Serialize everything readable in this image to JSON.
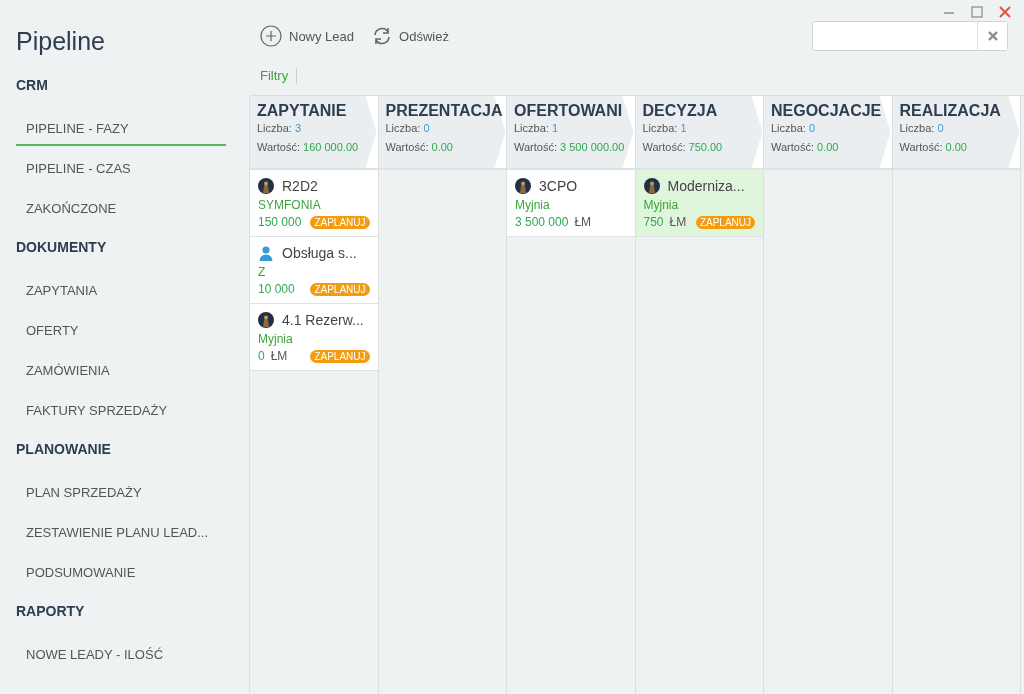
{
  "window": {
    "title": "Pipeline"
  },
  "sidebar": {
    "sections": [
      {
        "label": "CRM",
        "items": [
          {
            "label": "PIPELINE - FAZY",
            "selected": true
          },
          {
            "label": "PIPELINE - CZAS",
            "selected": false
          },
          {
            "label": "ZAKOŃCZONE",
            "selected": false
          }
        ]
      },
      {
        "label": "DOKUMENTY",
        "items": [
          {
            "label": "ZAPYTANIA",
            "selected": false
          },
          {
            "label": "OFERTY",
            "selected": false
          },
          {
            "label": "ZAMÓWIENIA",
            "selected": false
          },
          {
            "label": "FAKTURY SPRZEDAŻY",
            "selected": false
          }
        ]
      },
      {
        "label": "PLANOWANIE",
        "items": [
          {
            "label": "PLAN SPRZEDAŻY",
            "selected": false
          },
          {
            "label": "ZESTAWIENIE PLANU LEAD...",
            "selected": false
          },
          {
            "label": "PODSUMOWANIE",
            "selected": false
          }
        ]
      },
      {
        "label": "RAPORTY",
        "items": [
          {
            "label": "NOWE LEADY - ILOŚĆ",
            "selected": false
          }
        ]
      }
    ]
  },
  "toolbar": {
    "buttons": [
      {
        "label": "Nowy Lead",
        "kind": "add"
      },
      {
        "label": "Odśwież",
        "kind": "refresh"
      }
    ],
    "filter": "Filtry"
  },
  "stages": [
    {
      "title": "ZAPYTANIE",
      "count_label": "Liczba:",
      "count": "3",
      "value_label": "Wartość:",
      "value": "160 000.00",
      "cards": [
        {
          "kind": "avatar",
          "title": "R2D2",
          "client": "SYMFONIA",
          "amount": "150 000",
          "badge": "ZAPLANUJ",
          "highlighted": false
        },
        {
          "kind": "person",
          "title": "Obsługa s...",
          "client": "Z",
          "amount": "10 000",
          "badge": "ZAPLANUJ",
          "highlighted": false
        },
        {
          "kind": "avatar",
          "title": "4.1 Rezerw...",
          "client": "Myjnia",
          "amount": "0",
          "currency": "ŁM",
          "badge": "ZAPLANUJ",
          "highlighted": false
        }
      ]
    },
    {
      "title": "PREZENTACJA",
      "count_label": "Liczba:",
      "count": "0",
      "value_label": "Wartość:",
      "value": "0.00"
    },
    {
      "title": "OFERTOWANI",
      "count_label": "Liczba:",
      "count": "1",
      "value_label": "Wartość:",
      "value": "3 500 000.00",
      "cards": [
        {
          "kind": "avatar",
          "title": "3CPO",
          "client": "Myjnia",
          "amount": "3 500 000",
          "currency": "ŁM",
          "highlighted": false
        }
      ]
    },
    {
      "title": "DECYZJA",
      "count_label": "Liczba:",
      "count": "1",
      "value_label": "Wartość:",
      "value": "750.00",
      "cards": [
        {
          "kind": "avatar",
          "title": "Moderniza...",
          "client": "Myjnia",
          "amount": "750",
          "currency": "ŁM",
          "badge": "ZAPLANUJ",
          "highlighted": true
        }
      ]
    },
    {
      "title": "NEGOCJACJE",
      "count_label": "Liczba:",
      "count": "0",
      "value_label": "Wartość:",
      "value": "0.00"
    },
    {
      "title": "REALIZACJA",
      "count_label": "Liczba:",
      "count": "0",
      "value_label": "Wartość:",
      "value": "0.00"
    }
  ]
}
